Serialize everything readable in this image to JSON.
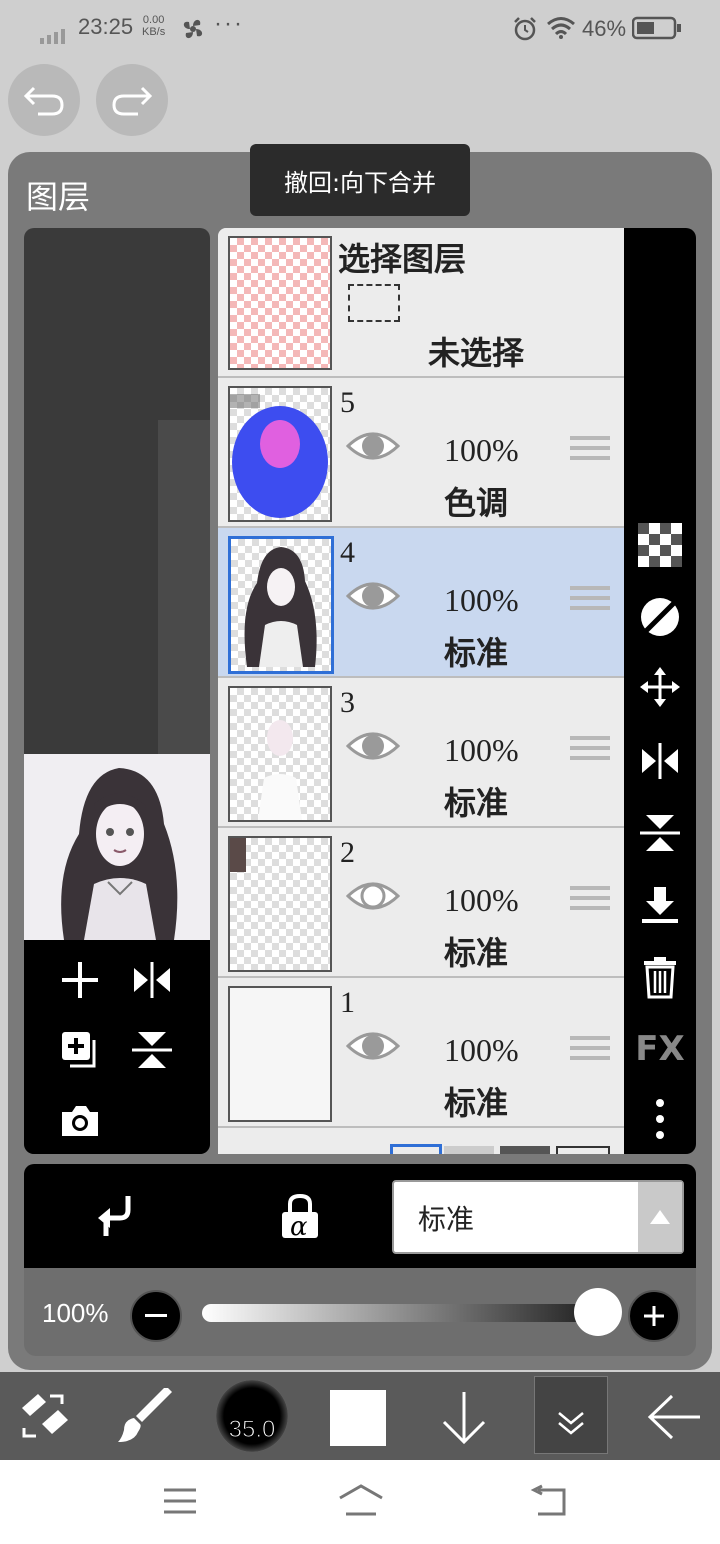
{
  "status": {
    "time": "23:25",
    "speed_value": "0.00",
    "speed_unit": "KB/s",
    "dots": "···",
    "battery": "46%"
  },
  "panel": {
    "title": "图层",
    "tooltip": "撤回:向下合并"
  },
  "selection_layer": {
    "title": "选择图层",
    "status": "未选择"
  },
  "layers": [
    {
      "number": "5",
      "opacity": "100%",
      "mode": "色调",
      "visible": true
    },
    {
      "number": "4",
      "opacity": "100%",
      "mode": "标准",
      "visible": true,
      "active": true
    },
    {
      "number": "3",
      "opacity": "100%",
      "mode": "标准",
      "visible": true
    },
    {
      "number": "2",
      "opacity": "100%",
      "mode": "标准",
      "visible": false
    },
    {
      "number": "1",
      "opacity": "100%",
      "mode": "标准",
      "visible": true
    }
  ],
  "right_toolbar": {
    "fx_label": "FX"
  },
  "blend": {
    "mode_value": "标准",
    "alpha_label": "α"
  },
  "opacity": {
    "label": "100%",
    "value": 1.0
  },
  "bottom_toolbar": {
    "brush_size": "35.0"
  },
  "colors": {
    "accent": "#2f6fd6",
    "active_layer_bg": "#c9d8ef",
    "panel_bg": "#7a7a7a"
  }
}
